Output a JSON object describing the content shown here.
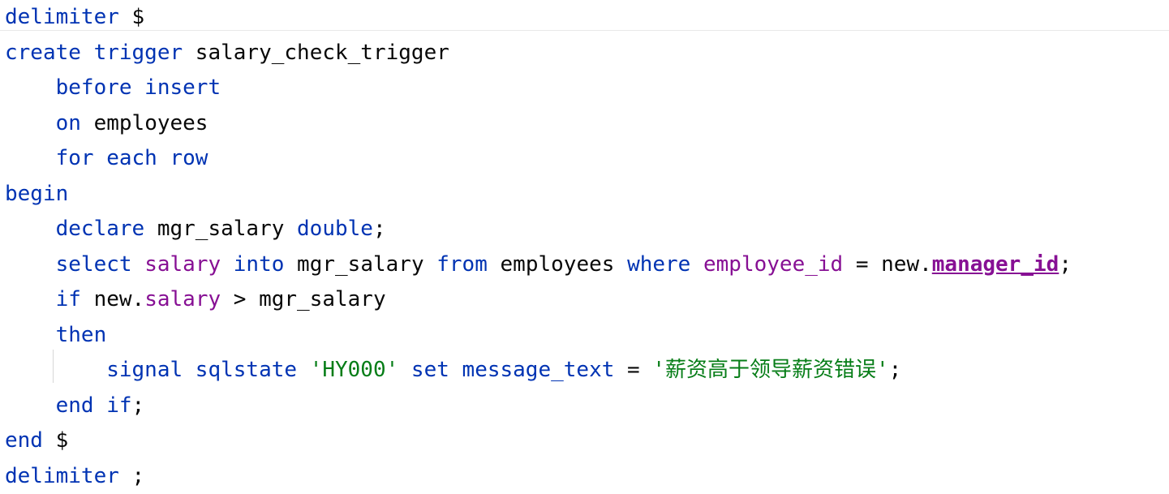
{
  "lines": [
    [
      {
        "t": "delimiter",
        "c": "kw"
      },
      {
        "t": " $",
        "c": "plain"
      }
    ],
    [
      {
        "t": "create trigger",
        "c": "kw"
      },
      {
        "t": " salary_check_trigger",
        "c": "plain"
      }
    ],
    [
      {
        "t": "    before insert",
        "c": "kw"
      }
    ],
    [
      {
        "t": "    on",
        "c": "kw"
      },
      {
        "t": " employees",
        "c": "plain"
      }
    ],
    [
      {
        "t": "    for each row",
        "c": "kw"
      }
    ],
    [
      {
        "t": "begin",
        "c": "kw"
      }
    ],
    [
      {
        "t": "    declare",
        "c": "kw"
      },
      {
        "t": " mgr_salary ",
        "c": "plain"
      },
      {
        "t": "double",
        "c": "kw"
      },
      {
        "t": ";",
        "c": "plain"
      }
    ],
    [
      {
        "t": "    select",
        "c": "kw"
      },
      {
        "t": " ",
        "c": "plain"
      },
      {
        "t": "salary",
        "c": "col"
      },
      {
        "t": " ",
        "c": "plain"
      },
      {
        "t": "into",
        "c": "kw"
      },
      {
        "t": " mgr_salary ",
        "c": "plain"
      },
      {
        "t": "from",
        "c": "kw"
      },
      {
        "t": " employees ",
        "c": "plain"
      },
      {
        "t": "where",
        "c": "kw"
      },
      {
        "t": " ",
        "c": "plain"
      },
      {
        "t": "employee_id",
        "c": "col"
      },
      {
        "t": " = new.",
        "c": "plain"
      },
      {
        "t": "manager_id",
        "c": "colu"
      },
      {
        "t": ";",
        "c": "plain"
      }
    ],
    [
      {
        "t": "    if",
        "c": "kw"
      },
      {
        "t": " new.",
        "c": "plain"
      },
      {
        "t": "salary",
        "c": "col"
      },
      {
        "t": " > mgr_salary",
        "c": "plain"
      }
    ],
    [
      {
        "t": "    then",
        "c": "kw"
      }
    ],
    [
      {
        "t": "        signal sqlstate",
        "c": "kw"
      },
      {
        "t": " ",
        "c": "plain"
      },
      {
        "t": "'HY000'",
        "c": "str"
      },
      {
        "t": " ",
        "c": "plain"
      },
      {
        "t": "set message_text",
        "c": "kw"
      },
      {
        "t": " = ",
        "c": "plain"
      },
      {
        "t": "'薪资高于领导薪资错误'",
        "c": "str"
      },
      {
        "t": ";",
        "c": "plain"
      }
    ],
    [
      {
        "t": "    end if",
        "c": "kw"
      },
      {
        "t": ";",
        "c": "plain"
      }
    ],
    [
      {
        "t": "end",
        "c": "kw"
      },
      {
        "t": " $",
        "c": "plain"
      }
    ],
    [
      {
        "t": "delimiter",
        "c": "kw"
      },
      {
        "t": " ;",
        "c": "plain"
      }
    ]
  ],
  "colors": {
    "keyword": "#0033b3",
    "column": "#871094",
    "string": "#067d17",
    "text": "#080808",
    "background": "#ffffff"
  }
}
